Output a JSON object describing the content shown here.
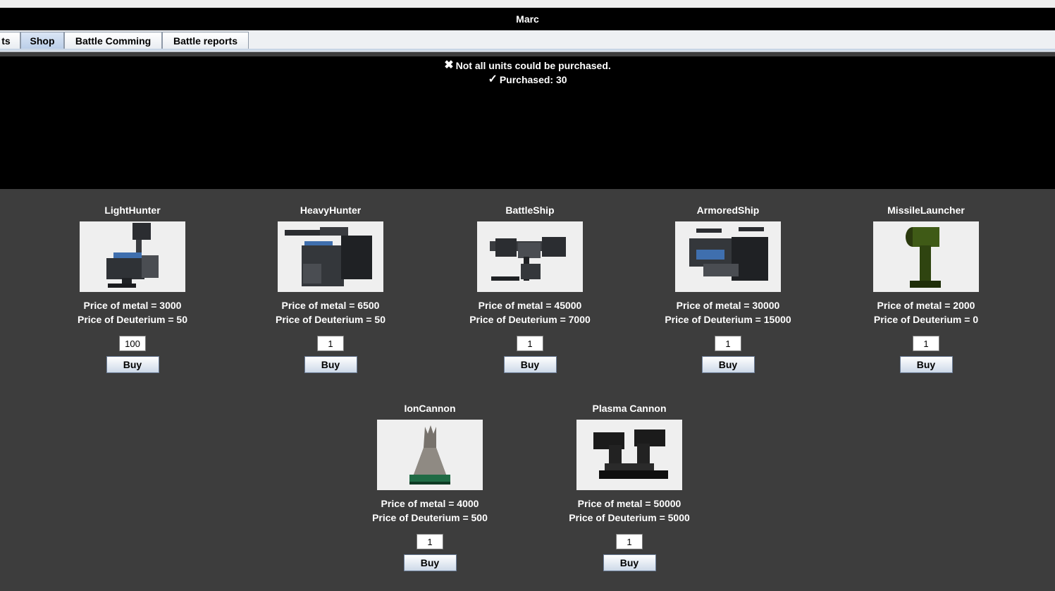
{
  "window": {
    "title": "Marc"
  },
  "tabs": [
    {
      "label": "ts",
      "selected": false
    },
    {
      "label": "Shop",
      "selected": true
    },
    {
      "label": "Battle Comming",
      "selected": false
    },
    {
      "label": "Battle reports",
      "selected": false
    }
  ],
  "messages": {
    "error_icon": "cross-icon",
    "error_text": "Not all units could be purchased.",
    "success_icon": "checkmark-icon",
    "success_text": "Purchased: 30"
  },
  "units": [
    {
      "name": "LightHunter",
      "metal_price": "Price of metal = 3000",
      "deuterium_price": "Price of Deuterium = 50",
      "quantity": "100",
      "buy_label": "Buy",
      "icon": "light-hunter-robot-icon"
    },
    {
      "name": "HeavyHunter",
      "metal_price": "Price of metal = 6500",
      "deuterium_price": "Price of Deuterium = 50",
      "quantity": "1",
      "buy_label": "Buy",
      "icon": "heavy-hunter-robot-icon"
    },
    {
      "name": "BattleShip",
      "metal_price": "Price of metal = 45000",
      "deuterium_price": "Price of Deuterium = 7000",
      "quantity": "1",
      "buy_label": "Buy",
      "icon": "battleship-icon"
    },
    {
      "name": "ArmoredShip",
      "metal_price": "Price of metal = 30000",
      "deuterium_price": "Price of Deuterium = 15000",
      "quantity": "1",
      "buy_label": "Buy",
      "icon": "armored-ship-icon"
    },
    {
      "name": "MissileLauncher",
      "metal_price": "Price of metal = 2000",
      "deuterium_price": "Price of Deuterium = 0",
      "quantity": "1",
      "buy_label": "Buy",
      "icon": "missile-launcher-icon"
    },
    {
      "name": "IonCannon",
      "metal_price": "Price of metal = 4000",
      "deuterium_price": "Price of Deuterium = 500",
      "quantity": "1",
      "buy_label": "Buy",
      "icon": "ion-cannon-icon"
    },
    {
      "name": "Plasma Cannon",
      "metal_price": "Price of metal = 50000",
      "deuterium_price": "Price of Deuterium = 5000",
      "quantity": "1",
      "buy_label": "Buy",
      "icon": "plasma-cannon-icon"
    }
  ],
  "colors": {
    "title_bar": "#000000",
    "message_panel": "#000000",
    "shop_background": "#3d3d3d",
    "image_background": "#efefef",
    "accent_blue": "#3a6fb3",
    "missile_green": "#3f5a16",
    "ion_base_green": "#1f6b45"
  }
}
